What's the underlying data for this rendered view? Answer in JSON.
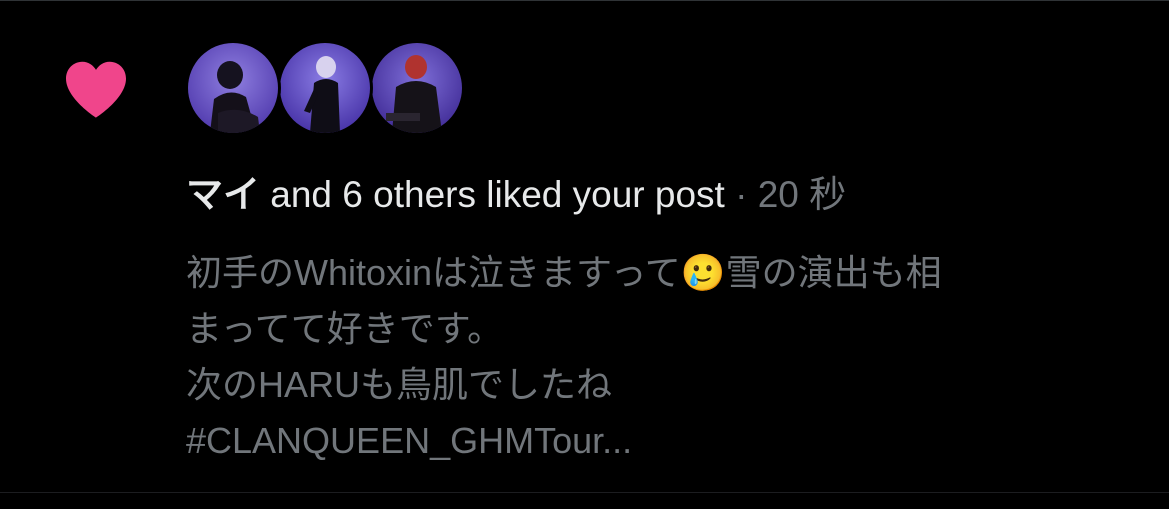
{
  "notification": {
    "icon": "heart-icon",
    "accent_color": "#f91880",
    "avatars": [
      "avatar-user-1",
      "avatar-user-2",
      "avatar-user-3"
    ],
    "user_name": "マイ",
    "action_text": " and 6 others liked your post",
    "separator": " · ",
    "time_ago": "20 秒",
    "post_lines": [
      "初手のWhitoxinは泣きますって🥲雪の演出も相",
      "まってて好きです。",
      "次のHARUも鳥肌でしたね",
      "#CLANQUEEN_GHMTour..."
    ]
  }
}
